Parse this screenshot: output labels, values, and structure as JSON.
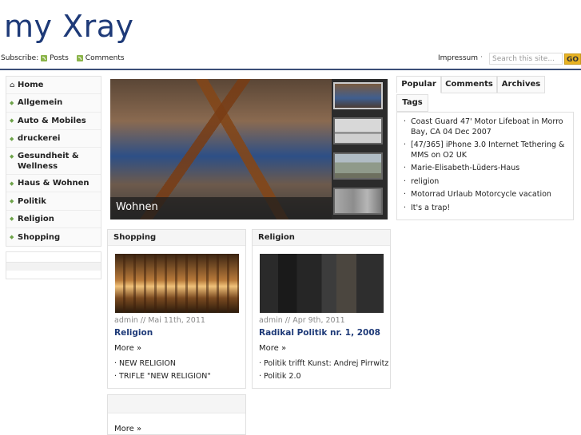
{
  "site": {
    "title": "my Xray"
  },
  "subscribe": {
    "label": "Subscribe:",
    "posts": "Posts",
    "comments": "Comments"
  },
  "topnav": {
    "impressum": "Impressum",
    "separator": "·"
  },
  "search": {
    "placeholder": "Search this site...",
    "go_label": "GO"
  },
  "sidebar": {
    "items": [
      {
        "label": "Home",
        "icon": "home-icon"
      },
      {
        "label": "Allgemein"
      },
      {
        "label": "Auto & Mobiles"
      },
      {
        "label": "druckerei"
      },
      {
        "label": "Gesundheit & Wellness"
      },
      {
        "label": "Haus & Wohnen"
      },
      {
        "label": "Politik"
      },
      {
        "label": "Religion"
      },
      {
        "label": "Shopping"
      }
    ]
  },
  "featured": {
    "caption": "Wohnen"
  },
  "tabs": {
    "labels": [
      "Popular",
      "Comments",
      "Archives",
      "Tags"
    ],
    "active": "Popular",
    "popular": [
      "Coast Guard 47' Motor Lifeboat in Morro Bay, CA 04 Dec 2007",
      "[47/365] iPhone 3.0 Internet Tethering & MMS on O2 UK",
      "Marie-Elisabeth-Lüders-Haus",
      "religion",
      "Motorrad Urlaub Motorcycle vacation",
      "It's a trap!"
    ]
  },
  "categories": [
    {
      "heading": "Shopping",
      "meta": "admin // Mai 11th, 2011",
      "title": "Religion",
      "more": "More »",
      "links": [
        "· NEW RELIGION",
        "· TRIFLE \"NEW RELIGION\""
      ]
    },
    {
      "heading": "Religion",
      "meta": "admin // Apr 9th, 2011",
      "title": "Radikal Politik nr. 1, 2008",
      "more": "More »",
      "links": [
        "· Politik trifft Kunst: Andrej Pirrwitz",
        "· Politik 2.0"
      ]
    },
    {
      "heading": "",
      "more": "More »"
    }
  ],
  "colors": {
    "title_blue": "#1e3a78",
    "accent_green": "#6ea34a",
    "go_button": "#e8b323",
    "rule": "#3b4f78"
  }
}
